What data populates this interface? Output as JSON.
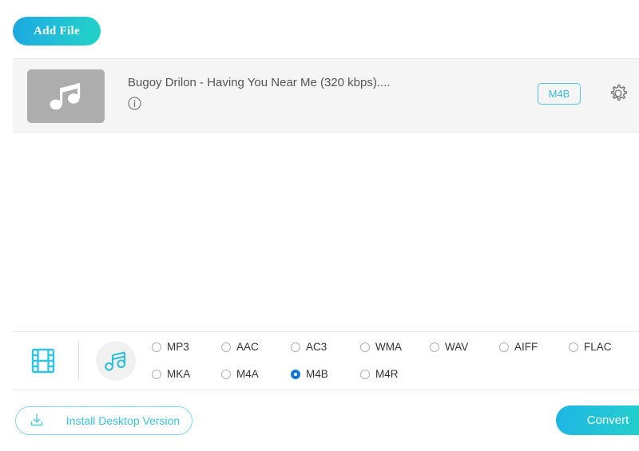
{
  "toolbar": {
    "add_file_label": "Add File"
  },
  "file_list": {
    "items": [
      {
        "title": "Bugoy Drilon - Having You Near Me (320 kbps)....",
        "thumb_icon": "music-note-icon",
        "info_icon": "info-icon",
        "format_badge": "M4B",
        "settings_icon": "gear-icon"
      }
    ]
  },
  "format_bar": {
    "video_tab_icon": "film-strip-icon",
    "audio_tab_icon": "music-note-icon",
    "rows": [
      [
        {
          "label": "MP3",
          "checked": false
        },
        {
          "label": "AAC",
          "checked": false
        },
        {
          "label": "AC3",
          "checked": false
        },
        {
          "label": "WMA",
          "checked": false
        },
        {
          "label": "WAV",
          "checked": false
        },
        {
          "label": "AIFF",
          "checked": false
        },
        {
          "label": "FLAC",
          "checked": false
        }
      ],
      [
        {
          "label": "MKA",
          "checked": false
        },
        {
          "label": "M4A",
          "checked": false
        },
        {
          "label": "M4B",
          "checked": true
        },
        {
          "label": "M4R",
          "checked": false
        }
      ]
    ],
    "selected_format": "M4B"
  },
  "bottom_bar": {
    "install_label": "Install Desktop Version",
    "install_icon": "download-icon",
    "convert_label": "Convert"
  },
  "colors": {
    "accent_cyan": "#3cc0e2",
    "accent_teal": "#22d4c4",
    "radio_selected_blue": "#1277d4",
    "row_background": "#f5f5f5",
    "thumb_gray": "#adadad"
  }
}
